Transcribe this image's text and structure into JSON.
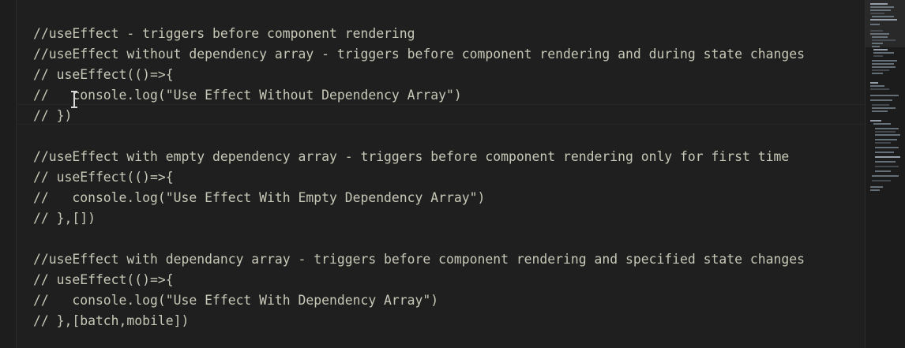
{
  "editor": {
    "lines": [
      "//useEffect - triggers before component rendering",
      "//useEffect without dependency array - triggers before component rendering and during state changes",
      "// useEffect(()=>{",
      "//   console.log(\"Use Effect Without Dependency Array\")",
      "// })",
      "",
      "//useEffect with empty dependency array - triggers before component rendering only for first time",
      "// useEffect(()=>{",
      "//   console.log(\"Use Effect With Empty Dependency Array\")",
      "// },[])",
      "",
      "//useEffect with dependancy array - triggers before component rendering and specified state changes",
      "// useEffect(()=>{",
      "//   console.log(\"Use Effect With Dependency Array\")",
      "// },[batch,mobile])"
    ]
  },
  "colors": {
    "background": "#1f1f1f",
    "comment_text": "#c8c8b8",
    "minimap_code": "#7c8a96"
  }
}
